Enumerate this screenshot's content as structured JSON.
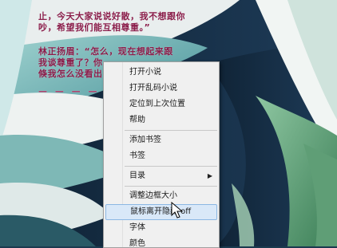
{
  "overlay": {
    "line1": "止，今天大家说说好散，我不想跟你",
    "line2": "吵，希望我们能互相尊重。”",
    "line3": "林正扬眉：“怎么，现在想起来跟",
    "line4": "我谈尊重了？你",
    "line5": "倏我怎么没看出",
    "dots": "— — — —"
  },
  "menu": {
    "items": [
      {
        "label": "打开小说"
      },
      {
        "label": "打开乱码小说"
      },
      {
        "label": "定位到上次位置"
      },
      {
        "label": "帮助"
      },
      {
        "label": "添加书签"
      },
      {
        "label": "书签"
      },
      {
        "label": "目录"
      },
      {
        "label": "调整边框大小"
      },
      {
        "label": "鼠标离开隐藏 off"
      },
      {
        "label": "字体"
      },
      {
        "label": "颜色"
      }
    ],
    "submenu_arrow": "▶"
  },
  "colors": {
    "overlay_text": "#8a1d4a",
    "menu_bg": "#f0f0f0",
    "highlight_bg": "#d9e8f8",
    "highlight_border": "#8cb7e3"
  },
  "icons": {
    "cursor": "mouse-pointer-icon",
    "submenu": "chevron-right-icon"
  }
}
